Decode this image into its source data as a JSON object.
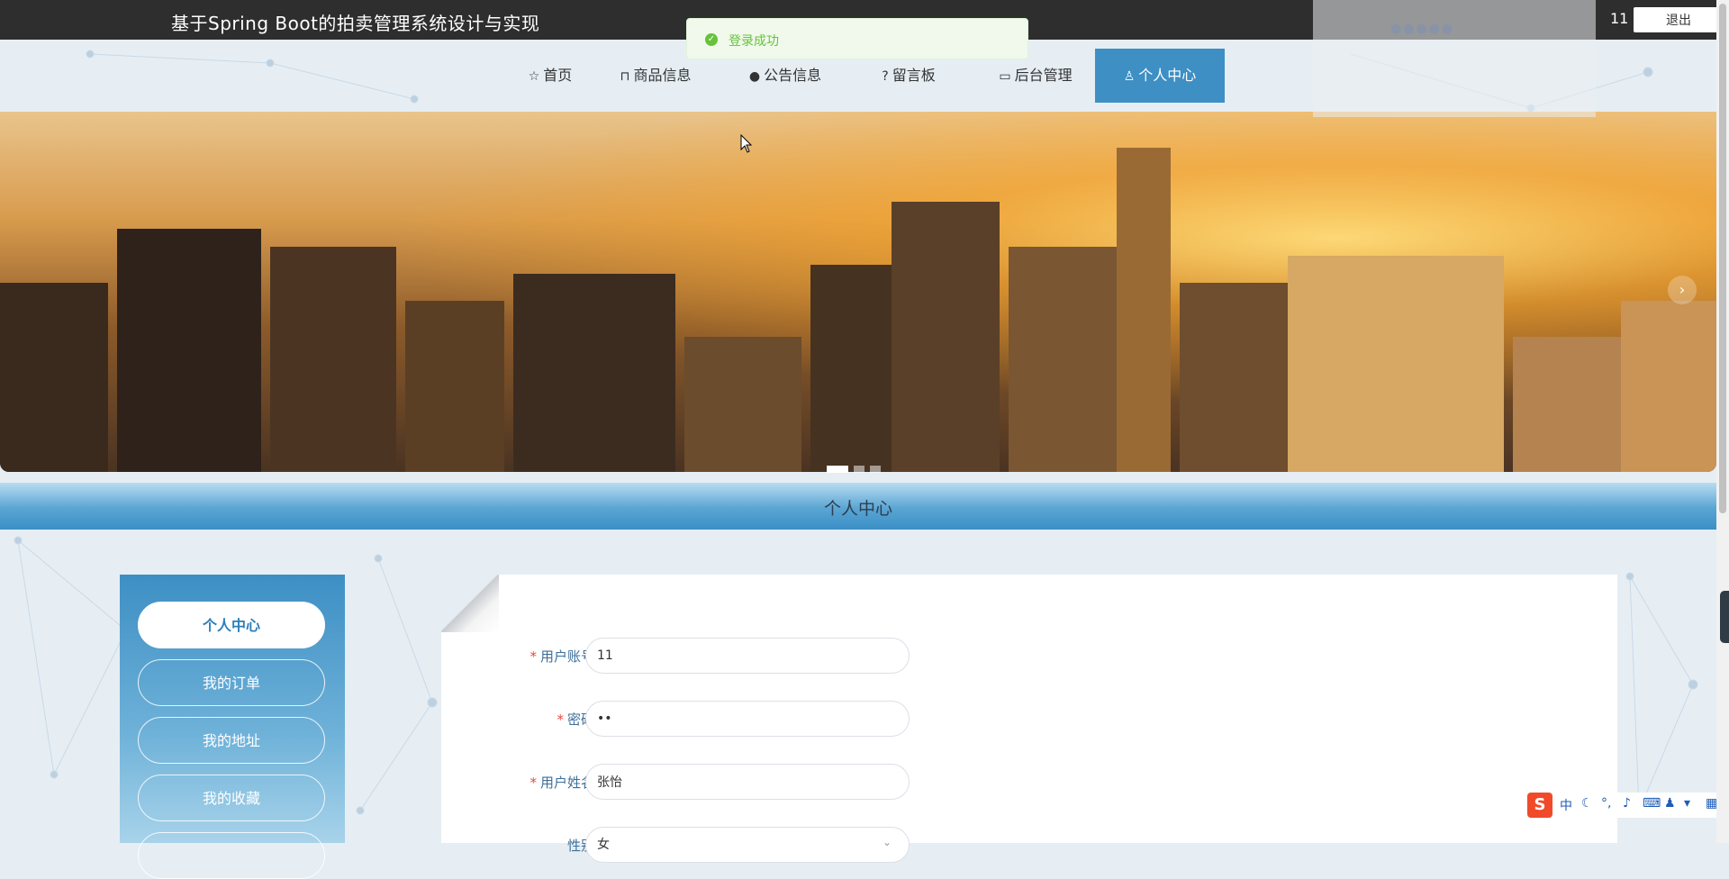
{
  "header": {
    "site_title": "基于Spring Boot的拍卖管理系统设计与实现",
    "user": "11",
    "logout_label": "退出"
  },
  "toast": {
    "message": "登录成功"
  },
  "nav": {
    "items": [
      {
        "label": "首页",
        "icon": "star-icon"
      },
      {
        "label": "商品信息",
        "icon": "bag-icon"
      },
      {
        "label": "公告信息",
        "icon": "alert-icon"
      },
      {
        "label": "留言板",
        "icon": "question-icon"
      },
      {
        "label": "后台管理",
        "icon": "briefcase-icon"
      },
      {
        "label": "个人中心",
        "icon": "user-icon",
        "active": true
      }
    ]
  },
  "banner": {
    "slide_count": 3,
    "active_slide": 1
  },
  "section": {
    "title": "个人中心"
  },
  "sidebar": {
    "items": [
      {
        "label": "个人中心",
        "active": true
      },
      {
        "label": "我的订单"
      },
      {
        "label": "我的地址"
      },
      {
        "label": "我的收藏"
      }
    ]
  },
  "form": {
    "username": {
      "label": "用户账号",
      "value": "11"
    },
    "password": {
      "label": "密码",
      "value": "••"
    },
    "realname": {
      "label": "用户姓名",
      "value": "张怡"
    },
    "gender": {
      "label": "性别",
      "value": "女"
    }
  },
  "ime": {
    "mode": "中"
  }
}
